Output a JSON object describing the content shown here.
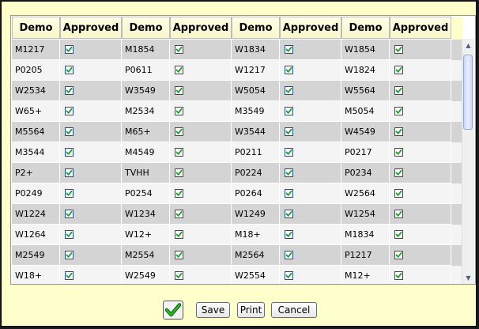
{
  "table": {
    "headers": [
      "Demo",
      "Approved",
      "Demo",
      "Approved",
      "Demo",
      "Approved",
      "Demo",
      "Approved"
    ],
    "rows": [
      [
        "M1217",
        "M1854",
        "W1834",
        "W1854"
      ],
      [
        "P0205",
        "P0611",
        "W1217",
        "W1824"
      ],
      [
        "W2534",
        "W3549",
        "W5054",
        "W5564"
      ],
      [
        "W65+",
        "M2534",
        "M3549",
        "M5054"
      ],
      [
        "M5564",
        "M65+",
        "W3544",
        "W4549"
      ],
      [
        "M3544",
        "M4549",
        "P0211",
        "P0217"
      ],
      [
        "P2+",
        "TVHH",
        "P0224",
        "P0234"
      ],
      [
        "P0249",
        "P0254",
        "P0264",
        "W2564"
      ],
      [
        "W1224",
        "W1234",
        "W1249",
        "W1254"
      ],
      [
        "W1264",
        "W12+",
        "M18+",
        "M1834"
      ],
      [
        "M2549",
        "M2554",
        "M2564",
        "P1217"
      ],
      [
        "W18+",
        "W2549",
        "W2554",
        "M12+"
      ]
    ],
    "approved": [
      [
        true,
        true,
        true,
        true
      ],
      [
        true,
        true,
        true,
        true
      ],
      [
        true,
        true,
        true,
        true
      ],
      [
        true,
        true,
        true,
        true
      ],
      [
        true,
        true,
        true,
        true
      ],
      [
        true,
        true,
        true,
        true
      ],
      [
        true,
        true,
        true,
        true
      ],
      [
        true,
        true,
        true,
        true
      ],
      [
        true,
        true,
        true,
        true
      ],
      [
        true,
        true,
        true,
        true
      ],
      [
        true,
        true,
        true,
        true
      ],
      [
        true,
        true,
        true,
        true
      ]
    ]
  },
  "footer": {
    "ok_icon": "green-checkmark-icon",
    "save_label": "Save",
    "print_label": "Print",
    "cancel_label": "Cancel"
  },
  "colors": {
    "dialog_bg": "#ffffcc",
    "row_odd": "#d4d4d4",
    "row_even": "#f4f4f4",
    "check_green": "#1f9a2e",
    "ok_check_green": "#1d8a1d"
  }
}
